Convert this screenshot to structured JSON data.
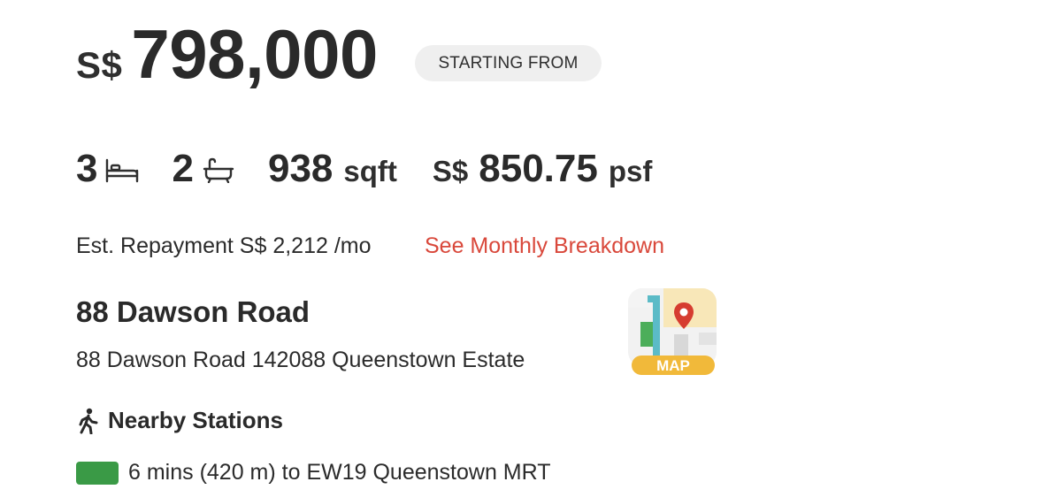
{
  "price": {
    "currency": "S$",
    "amount": "798,000",
    "badge": "STARTING FROM"
  },
  "specs": {
    "bedrooms": "3",
    "bedroom_icon": "bed-icon",
    "bathrooms": "2",
    "bathroom_icon": "bathtub-icon",
    "size_value": "938",
    "size_unit": "sqft",
    "psf_currency": "S$",
    "psf_value": "850.75",
    "psf_unit": "psf"
  },
  "repayment": {
    "text": "Est. Repayment S$ 2,212 /mo",
    "link": "See Monthly Breakdown"
  },
  "address": {
    "title": "88 Dawson Road",
    "full": "88 Dawson Road 142088 Queenstown Estate",
    "map_label": "MAP"
  },
  "nearby": {
    "title": "Nearby Stations",
    "icon": "walking-person-icon",
    "stations": [
      {
        "text": "6 mins (420 m) to EW19 Queenstown MRT",
        "line_color": "#3a9a46"
      }
    ]
  },
  "colors": {
    "link": "#d9483b",
    "badge_bg": "#efefef",
    "map_label_bg": "#f1b93a"
  }
}
